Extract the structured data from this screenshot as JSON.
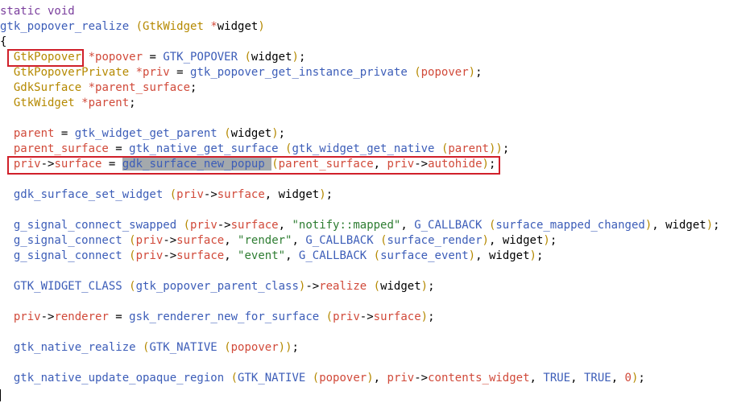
{
  "lines": [
    [
      {
        "t": "static void",
        "c": "kw"
      }
    ],
    [
      {
        "t": "gtk_popover_realize",
        "c": "fn"
      },
      {
        "t": " ",
        "c": "op"
      },
      {
        "t": "(",
        "c": "br"
      },
      {
        "t": "GtkWidget",
        "c": "ty"
      },
      {
        "t": " *",
        "c": "va"
      },
      {
        "t": "widget",
        "c": "op"
      },
      {
        "t": ")",
        "c": "br"
      }
    ],
    [
      {
        "t": "{",
        "c": "op"
      }
    ],
    [
      {
        "t": "  ",
        "c": "op"
      },
      {
        "t": "GtkPopover",
        "c": "ty"
      },
      {
        "t": " *",
        "c": "va"
      },
      {
        "t": "popover",
        "c": "va"
      },
      {
        "t": " = ",
        "c": "op"
      },
      {
        "t": "GTK_POPOVER",
        "c": "mc"
      },
      {
        "t": " ",
        "c": "op"
      },
      {
        "t": "(",
        "c": "br"
      },
      {
        "t": "widget",
        "c": "op"
      },
      {
        "t": ")",
        "c": "br"
      },
      {
        "t": ";",
        "c": "op"
      }
    ],
    [
      {
        "t": "  ",
        "c": "op"
      },
      {
        "t": "GtkPopoverPrivate",
        "c": "ty"
      },
      {
        "t": " *",
        "c": "va"
      },
      {
        "t": "priv",
        "c": "va"
      },
      {
        "t": " = ",
        "c": "op"
      },
      {
        "t": "gtk_popover_get_instance_private",
        "c": "fn"
      },
      {
        "t": " ",
        "c": "op"
      },
      {
        "t": "(",
        "c": "br"
      },
      {
        "t": "popover",
        "c": "va"
      },
      {
        "t": ")",
        "c": "br"
      },
      {
        "t": ";",
        "c": "op"
      }
    ],
    [
      {
        "t": "  ",
        "c": "op"
      },
      {
        "t": "GdkSurface",
        "c": "ty"
      },
      {
        "t": " *",
        "c": "va"
      },
      {
        "t": "parent_surface",
        "c": "va"
      },
      {
        "t": ";",
        "c": "op"
      }
    ],
    [
      {
        "t": "  ",
        "c": "op"
      },
      {
        "t": "GtkWidget",
        "c": "ty"
      },
      {
        "t": " *",
        "c": "va"
      },
      {
        "t": "parent",
        "c": "va"
      },
      {
        "t": ";",
        "c": "op"
      }
    ],
    [],
    [
      {
        "t": "  ",
        "c": "op"
      },
      {
        "t": "parent",
        "c": "va"
      },
      {
        "t": " = ",
        "c": "op"
      },
      {
        "t": "gtk_widget_get_parent",
        "c": "fn"
      },
      {
        "t": " ",
        "c": "op"
      },
      {
        "t": "(",
        "c": "br"
      },
      {
        "t": "widget",
        "c": "op"
      },
      {
        "t": ")",
        "c": "br"
      },
      {
        "t": ";",
        "c": "op"
      }
    ],
    [
      {
        "t": "  ",
        "c": "op"
      },
      {
        "t": "parent_surface",
        "c": "va"
      },
      {
        "t": " = ",
        "c": "op"
      },
      {
        "t": "gtk_native_get_surface",
        "c": "fn"
      },
      {
        "t": " ",
        "c": "op"
      },
      {
        "t": "(",
        "c": "br"
      },
      {
        "t": "gtk_widget_get_native",
        "c": "fn"
      },
      {
        "t": " ",
        "c": "op"
      },
      {
        "t": "(",
        "c": "br"
      },
      {
        "t": "parent",
        "c": "va"
      },
      {
        "t": ")",
        "c": "br"
      },
      {
        "t": ")",
        "c": "br"
      },
      {
        "t": ";",
        "c": "op"
      }
    ],
    [
      {
        "t": "  ",
        "c": "op"
      },
      {
        "t": "priv",
        "c": "va"
      },
      {
        "t": "->",
        "c": "op"
      },
      {
        "t": "surface",
        "c": "va"
      },
      {
        "t": " = ",
        "c": "op"
      },
      {
        "t": "gdk_surface_new_popup",
        "c": "sel"
      },
      {
        "t": " ",
        "c": "sel"
      },
      {
        "t": "(",
        "c": "br"
      },
      {
        "t": "parent_surface",
        "c": "va"
      },
      {
        "t": ", ",
        "c": "op"
      },
      {
        "t": "priv",
        "c": "va"
      },
      {
        "t": "->",
        "c": "op"
      },
      {
        "t": "autohide",
        "c": "va"
      },
      {
        "t": ")",
        "c": "br"
      },
      {
        "t": ";",
        "c": "op"
      }
    ],
    [],
    [
      {
        "t": "  ",
        "c": "op"
      },
      {
        "t": "gdk_surface_set_widget",
        "c": "fn"
      },
      {
        "t": " ",
        "c": "op"
      },
      {
        "t": "(",
        "c": "br"
      },
      {
        "t": "priv",
        "c": "va"
      },
      {
        "t": "->",
        "c": "op"
      },
      {
        "t": "surface",
        "c": "va"
      },
      {
        "t": ", ",
        "c": "op"
      },
      {
        "t": "widget",
        "c": "op"
      },
      {
        "t": ")",
        "c": "br"
      },
      {
        "t": ";",
        "c": "op"
      }
    ],
    [],
    [
      {
        "t": "  ",
        "c": "op"
      },
      {
        "t": "g_signal_connect_swapped",
        "c": "fn"
      },
      {
        "t": " ",
        "c": "op"
      },
      {
        "t": "(",
        "c": "br"
      },
      {
        "t": "priv",
        "c": "va"
      },
      {
        "t": "->",
        "c": "op"
      },
      {
        "t": "surface",
        "c": "va"
      },
      {
        "t": ", ",
        "c": "op"
      },
      {
        "t": "\"notify::mapped\"",
        "c": "st"
      },
      {
        "t": ", ",
        "c": "op"
      },
      {
        "t": "G_CALLBACK",
        "c": "mc"
      },
      {
        "t": " ",
        "c": "op"
      },
      {
        "t": "(",
        "c": "br"
      },
      {
        "t": "surface_mapped_changed",
        "c": "fn"
      },
      {
        "t": ")",
        "c": "br"
      },
      {
        "t": ", ",
        "c": "op"
      },
      {
        "t": "widget",
        "c": "op"
      },
      {
        "t": ")",
        "c": "br"
      },
      {
        "t": ";",
        "c": "op"
      }
    ],
    [
      {
        "t": "  ",
        "c": "op"
      },
      {
        "t": "g_signal_connect",
        "c": "fn"
      },
      {
        "t": " ",
        "c": "op"
      },
      {
        "t": "(",
        "c": "br"
      },
      {
        "t": "priv",
        "c": "va"
      },
      {
        "t": "->",
        "c": "op"
      },
      {
        "t": "surface",
        "c": "va"
      },
      {
        "t": ", ",
        "c": "op"
      },
      {
        "t": "\"render\"",
        "c": "st"
      },
      {
        "t": ", ",
        "c": "op"
      },
      {
        "t": "G_CALLBACK",
        "c": "mc"
      },
      {
        "t": " ",
        "c": "op"
      },
      {
        "t": "(",
        "c": "br"
      },
      {
        "t": "surface_render",
        "c": "fn"
      },
      {
        "t": ")",
        "c": "br"
      },
      {
        "t": ", ",
        "c": "op"
      },
      {
        "t": "widget",
        "c": "op"
      },
      {
        "t": ")",
        "c": "br"
      },
      {
        "t": ";",
        "c": "op"
      }
    ],
    [
      {
        "t": "  ",
        "c": "op"
      },
      {
        "t": "g_signal_connect",
        "c": "fn"
      },
      {
        "t": " ",
        "c": "op"
      },
      {
        "t": "(",
        "c": "br"
      },
      {
        "t": "priv",
        "c": "va"
      },
      {
        "t": "->",
        "c": "op"
      },
      {
        "t": "surface",
        "c": "va"
      },
      {
        "t": ", ",
        "c": "op"
      },
      {
        "t": "\"event\"",
        "c": "st"
      },
      {
        "t": ", ",
        "c": "op"
      },
      {
        "t": "G_CALLBACK",
        "c": "mc"
      },
      {
        "t": " ",
        "c": "op"
      },
      {
        "t": "(",
        "c": "br"
      },
      {
        "t": "surface_event",
        "c": "fn"
      },
      {
        "t": ")",
        "c": "br"
      },
      {
        "t": ", ",
        "c": "op"
      },
      {
        "t": "widget",
        "c": "op"
      },
      {
        "t": ")",
        "c": "br"
      },
      {
        "t": ";",
        "c": "op"
      }
    ],
    [],
    [
      {
        "t": "  ",
        "c": "op"
      },
      {
        "t": "GTK_WIDGET_CLASS",
        "c": "mc"
      },
      {
        "t": " ",
        "c": "op"
      },
      {
        "t": "(",
        "c": "br"
      },
      {
        "t": "gtk_popover_parent_class",
        "c": "fn"
      },
      {
        "t": ")",
        "c": "br"
      },
      {
        "t": "->",
        "c": "op"
      },
      {
        "t": "realize",
        "c": "va"
      },
      {
        "t": " ",
        "c": "op"
      },
      {
        "t": "(",
        "c": "br"
      },
      {
        "t": "widget",
        "c": "op"
      },
      {
        "t": ")",
        "c": "br"
      },
      {
        "t": ";",
        "c": "op"
      }
    ],
    [],
    [
      {
        "t": "  ",
        "c": "op"
      },
      {
        "t": "priv",
        "c": "va"
      },
      {
        "t": "->",
        "c": "op"
      },
      {
        "t": "renderer",
        "c": "va"
      },
      {
        "t": " = ",
        "c": "op"
      },
      {
        "t": "gsk_renderer_new_for_surface",
        "c": "fn"
      },
      {
        "t": " ",
        "c": "op"
      },
      {
        "t": "(",
        "c": "br"
      },
      {
        "t": "priv",
        "c": "va"
      },
      {
        "t": "->",
        "c": "op"
      },
      {
        "t": "surface",
        "c": "va"
      },
      {
        "t": ")",
        "c": "br"
      },
      {
        "t": ";",
        "c": "op"
      }
    ],
    [],
    [
      {
        "t": "  ",
        "c": "op"
      },
      {
        "t": "gtk_native_realize",
        "c": "fn"
      },
      {
        "t": " ",
        "c": "op"
      },
      {
        "t": "(",
        "c": "br"
      },
      {
        "t": "GTK_NATIVE",
        "c": "mc"
      },
      {
        "t": " ",
        "c": "op"
      },
      {
        "t": "(",
        "c": "br"
      },
      {
        "t": "popover",
        "c": "va"
      },
      {
        "t": ")",
        "c": "br"
      },
      {
        "t": ")",
        "c": "br"
      },
      {
        "t": ";",
        "c": "op"
      }
    ],
    [],
    [
      {
        "t": "  ",
        "c": "op"
      },
      {
        "t": "gtk_native_update_opaque_region",
        "c": "fn"
      },
      {
        "t": " ",
        "c": "op"
      },
      {
        "t": "(",
        "c": "br"
      },
      {
        "t": "GTK_NATIVE",
        "c": "mc"
      },
      {
        "t": " ",
        "c": "op"
      },
      {
        "t": "(",
        "c": "br"
      },
      {
        "t": "popover",
        "c": "va"
      },
      {
        "t": ")",
        "c": "br"
      },
      {
        "t": ", ",
        "c": "op"
      },
      {
        "t": "priv",
        "c": "va"
      },
      {
        "t": "->",
        "c": "op"
      },
      {
        "t": "contents_widget",
        "c": "va"
      },
      {
        "t": ", ",
        "c": "op"
      },
      {
        "t": "TRUE",
        "c": "mc"
      },
      {
        "t": ", ",
        "c": "op"
      },
      {
        "t": "TRUE",
        "c": "mc"
      },
      {
        "t": ", ",
        "c": "op"
      },
      {
        "t": "0",
        "c": "nu"
      },
      {
        "t": ")",
        "c": "br"
      },
      {
        "t": ";",
        "c": "op"
      }
    ]
  ],
  "colors": {
    "highlight_box": "#d0202a",
    "selection": "#a4a9ac",
    "type": "#b58900",
    "function": "#3c5db8",
    "variable": "#d14a3a",
    "string": "#2e7d32",
    "keyword": "#7a3e9d"
  }
}
